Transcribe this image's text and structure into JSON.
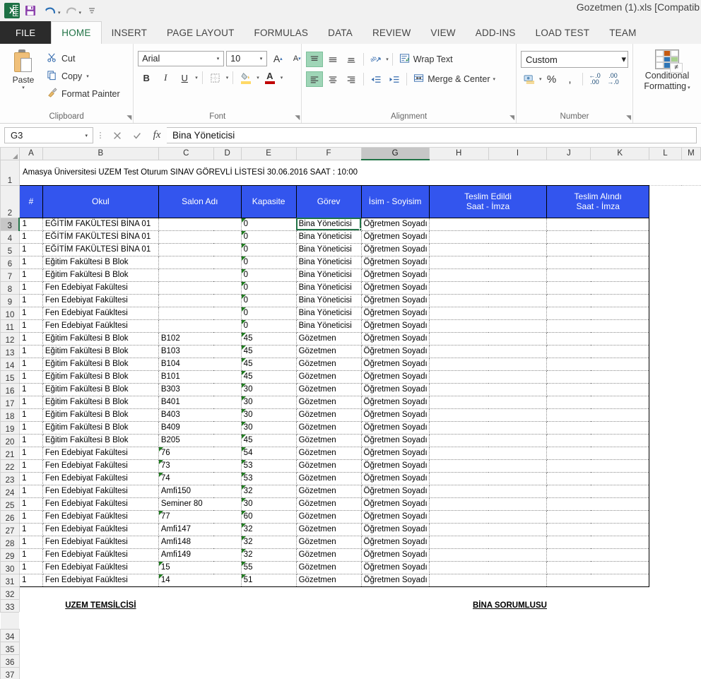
{
  "window": {
    "document_title": "Gozetmen (1).xls  [Compatib",
    "app_icon": "excel-logo-icon"
  },
  "quick_access": {
    "save": "save-icon",
    "undo": "undo-icon",
    "redo": "redo-icon",
    "customize": "customize-qat-icon"
  },
  "ribbon_tabs": [
    {
      "label": "FILE",
      "active": false
    },
    {
      "label": "HOME",
      "active": true
    },
    {
      "label": "INSERT",
      "active": false
    },
    {
      "label": "PAGE LAYOUT",
      "active": false
    },
    {
      "label": "FORMULAS",
      "active": false
    },
    {
      "label": "DATA",
      "active": false
    },
    {
      "label": "REVIEW",
      "active": false
    },
    {
      "label": "VIEW",
      "active": false
    },
    {
      "label": "ADD-INS",
      "active": false
    },
    {
      "label": "LOAD TEST",
      "active": false
    },
    {
      "label": "TEAM",
      "active": false
    }
  ],
  "ribbon": {
    "clipboard": {
      "group_label": "Clipboard",
      "paste_label": "Paste",
      "cut_label": "Cut",
      "copy_label": "Copy",
      "format_painter_label": "Format Painter"
    },
    "font": {
      "group_label": "Font",
      "font_name": "Arial",
      "font_size": "10",
      "bold_label": "B",
      "italic_label": "I",
      "underline_label": "U",
      "grow_font_label": "A",
      "shrink_font_label": "A",
      "fill_color": "#ffd966",
      "font_color": "#c00000"
    },
    "alignment": {
      "group_label": "Alignment",
      "wrap_text_label": "Wrap Text",
      "merge_center_label": "Merge & Center"
    },
    "number": {
      "group_label": "Number",
      "format_value": "Custom",
      "percent_label": "%",
      "comma_label": ",",
      "increase_decimal_label": ".00",
      "decrease_decimal_label": ".00"
    },
    "styles": {
      "conditional_formatting_line1": "Conditional",
      "conditional_formatting_line2": "Formatting"
    }
  },
  "formula_bar": {
    "name_box_value": "G3",
    "cancel_icon": "cancel-icon",
    "enter_icon": "confirm-icon",
    "fx_icon": "insert-function-icon",
    "content": "Bina Yöneticisi"
  },
  "sheet": {
    "columns": [
      "A",
      "B",
      "C",
      "D",
      "E",
      "F",
      "G",
      "H",
      "I",
      "J",
      "K",
      "L",
      "M"
    ],
    "selected_column": "G",
    "selected_row": 3,
    "selected_cell": "G3",
    "row_numbers": [
      1,
      2,
      3,
      4,
      5,
      6,
      7,
      8,
      9,
      10,
      11,
      12,
      13,
      14,
      15,
      16,
      17,
      18,
      19,
      20,
      21,
      22,
      23,
      24,
      25,
      26,
      27,
      28,
      29,
      30,
      31,
      32,
      33,
      34,
      35,
      36,
      37
    ],
    "title_row": "Amasya Üniversitesi UZEM Test Oturum  SINAV GÖREVLİ LİSTESİ 30.06.2016 SAAT : 10:00",
    "headers": [
      {
        "label": "#"
      },
      {
        "label": "Okul"
      },
      {
        "label": "Salon Adı"
      },
      {
        "label": "Kapasite"
      },
      {
        "label": "Görev"
      },
      {
        "label": "İsim - Soyisim"
      },
      {
        "line1": "Teslim Edildi",
        "line2": "Saat - İmza"
      },
      {
        "line1": "Teslim Alındı",
        "line2": "Saat - İmza"
      }
    ],
    "rows": [
      {
        "row": 3,
        "num": "1",
        "okul": "EĞİTİM FAKÜLTESİ BİNA 01",
        "salon": "",
        "kapasite": "0",
        "gorev": "Bina Yöneticisi",
        "isim": "Öğretmen Soyadı",
        "teslim_edildi": "",
        "teslim_alindi": "",
        "salon_err": false,
        "kapasite_err": true
      },
      {
        "row": 4,
        "num": "1",
        "okul": "EĞİTİM FAKÜLTESİ BİNA 01",
        "salon": "",
        "kapasite": "0",
        "gorev": "Bina Yöneticisi",
        "isim": "Öğretmen Soyadı",
        "teslim_edildi": "",
        "teslim_alindi": "",
        "salon_err": false,
        "kapasite_err": true
      },
      {
        "row": 5,
        "num": "1",
        "okul": "EĞİTİM FAKÜLTESİ BİNA 01",
        "salon": "",
        "kapasite": "0",
        "gorev": "Bina Yöneticisi",
        "isim": "Öğretmen Soyadı",
        "teslim_edildi": "",
        "teslim_alindi": "",
        "salon_err": false,
        "kapasite_err": true
      },
      {
        "row": 6,
        "num": "1",
        "okul": "Eğitim Fakültesi B Blok",
        "salon": "",
        "kapasite": "0",
        "gorev": "Bina Yöneticisi",
        "isim": "Öğretmen Soyadı",
        "teslim_edildi": "",
        "teslim_alindi": "",
        "salon_err": false,
        "kapasite_err": true
      },
      {
        "row": 7,
        "num": "1",
        "okul": "Eğitim Fakültesi B Blok",
        "salon": "",
        "kapasite": "0",
        "gorev": "Bina Yöneticisi",
        "isim": "Öğretmen Soyadı",
        "teslim_edildi": "",
        "teslim_alindi": "",
        "salon_err": false,
        "kapasite_err": true
      },
      {
        "row": 8,
        "num": "1",
        "okul": "Fen Edebiyat Fakültesi",
        "salon": "",
        "kapasite": "0",
        "gorev": "Bina Yöneticisi",
        "isim": "Öğretmen Soyadı",
        "teslim_edildi": "",
        "teslim_alindi": "",
        "salon_err": false,
        "kapasite_err": true
      },
      {
        "row": 9,
        "num": "1",
        "okul": "Fen Edebiyat Fakültesi",
        "salon": "",
        "kapasite": "0",
        "gorev": "Bina Yöneticisi",
        "isim": "Öğretmen Soyadı",
        "teslim_edildi": "",
        "teslim_alindi": "",
        "salon_err": false,
        "kapasite_err": true
      },
      {
        "row": 10,
        "num": "1",
        "okul": "Fen Edebiyat Faükltesi",
        "salon": "",
        "kapasite": "0",
        "gorev": "Bina Yöneticisi",
        "isim": "Öğretmen Soyadı",
        "teslim_edildi": "",
        "teslim_alindi": "",
        "salon_err": false,
        "kapasite_err": true
      },
      {
        "row": 11,
        "num": "1",
        "okul": "Fen Edebiyat Faükltesi",
        "salon": "",
        "kapasite": "0",
        "gorev": "Bina Yöneticisi",
        "isim": "Öğretmen Soyadı",
        "teslim_edildi": "",
        "teslim_alindi": "",
        "salon_err": false,
        "kapasite_err": true
      },
      {
        "row": 12,
        "num": "1",
        "okul": "Eğitim Fakültesi B Blok",
        "salon": "B102",
        "kapasite": "45",
        "gorev": "Gözetmen",
        "isim": "Öğretmen Soyadı",
        "teslim_edildi": "",
        "teslim_alindi": "",
        "salon_err": false,
        "kapasite_err": true
      },
      {
        "row": 13,
        "num": "1",
        "okul": "Eğitim Fakültesi B Blok",
        "salon": "B103",
        "kapasite": "45",
        "gorev": "Gözetmen",
        "isim": "Öğretmen Soyadı",
        "teslim_edildi": "",
        "teslim_alindi": "",
        "salon_err": false,
        "kapasite_err": true
      },
      {
        "row": 14,
        "num": "1",
        "okul": "Eğitim Fakültesi B Blok",
        "salon": "B104",
        "kapasite": "45",
        "gorev": "Gözetmen",
        "isim": "Öğretmen Soyadı",
        "teslim_edildi": "",
        "teslim_alindi": "",
        "salon_err": false,
        "kapasite_err": true
      },
      {
        "row": 15,
        "num": "1",
        "okul": "Eğitim Fakültesi B Blok",
        "salon": "B101",
        "kapasite": "45",
        "gorev": "Gözetmen",
        "isim": "Öğretmen Soyadı",
        "teslim_edildi": "",
        "teslim_alindi": "",
        "salon_err": false,
        "kapasite_err": true
      },
      {
        "row": 16,
        "num": "1",
        "okul": "Eğitim Fakültesi B Blok",
        "salon": "B303",
        "kapasite": "30",
        "gorev": "Gözetmen",
        "isim": "Öğretmen Soyadı",
        "teslim_edildi": "",
        "teslim_alindi": "",
        "salon_err": false,
        "kapasite_err": true
      },
      {
        "row": 17,
        "num": "1",
        "okul": "Eğitim Fakültesi B Blok",
        "salon": "B401",
        "kapasite": "30",
        "gorev": "Gözetmen",
        "isim": "Öğretmen Soyadı",
        "teslim_edildi": "",
        "teslim_alindi": "",
        "salon_err": false,
        "kapasite_err": true
      },
      {
        "row": 18,
        "num": "1",
        "okul": "Eğitim Fakültesi B Blok",
        "salon": "B403",
        "kapasite": "30",
        "gorev": "Gözetmen",
        "isim": "Öğretmen Soyadı",
        "teslim_edildi": "",
        "teslim_alindi": "",
        "salon_err": false,
        "kapasite_err": true
      },
      {
        "row": 19,
        "num": "1",
        "okul": "Eğitim Fakültesi B Blok",
        "salon": "B409",
        "kapasite": "30",
        "gorev": "Gözetmen",
        "isim": "Öğretmen Soyadı",
        "teslim_edildi": "",
        "teslim_alindi": "",
        "salon_err": false,
        "kapasite_err": true
      },
      {
        "row": 20,
        "num": "1",
        "okul": "Eğitim Fakültesi B Blok",
        "salon": "B205",
        "kapasite": "45",
        "gorev": "Gözetmen",
        "isim": "Öğretmen Soyadı",
        "teslim_edildi": "",
        "teslim_alindi": "",
        "salon_err": false,
        "kapasite_err": true
      },
      {
        "row": 21,
        "num": "1",
        "okul": "Fen Edebiyat Fakültesi",
        "salon": "76",
        "kapasite": "54",
        "gorev": "Gözetmen",
        "isim": "Öğretmen Soyadı",
        "teslim_edildi": "",
        "teslim_alindi": "",
        "salon_err": true,
        "kapasite_err": true
      },
      {
        "row": 22,
        "num": "1",
        "okul": "Fen Edebiyat Fakültesi",
        "salon": "73",
        "kapasite": "53",
        "gorev": "Gözetmen",
        "isim": "Öğretmen Soyadı",
        "teslim_edildi": "",
        "teslim_alindi": "",
        "salon_err": true,
        "kapasite_err": true
      },
      {
        "row": 23,
        "num": "1",
        "okul": "Fen Edebiyat Fakültesi",
        "salon": "74",
        "kapasite": "53",
        "gorev": "Gözetmen",
        "isim": "Öğretmen Soyadı",
        "teslim_edildi": "",
        "teslim_alindi": "",
        "salon_err": true,
        "kapasite_err": true
      },
      {
        "row": 24,
        "num": "1",
        "okul": "Fen Edebiyat Fakültesi",
        "salon": "Amfi150",
        "kapasite": "32",
        "gorev": "Gözetmen",
        "isim": "Öğretmen Soyadı",
        "teslim_edildi": "",
        "teslim_alindi": "",
        "salon_err": false,
        "kapasite_err": true
      },
      {
        "row": 25,
        "num": "1",
        "okul": "Fen Edebiyat Fakültesi",
        "salon": "Seminer 80",
        "kapasite": "30",
        "gorev": "Gözetmen",
        "isim": "Öğretmen Soyadı",
        "teslim_edildi": "",
        "teslim_alindi": "",
        "salon_err": false,
        "kapasite_err": true
      },
      {
        "row": 26,
        "num": "1",
        "okul": "Fen Edebiyat Faükltesi",
        "salon": "77",
        "kapasite": "60",
        "gorev": "Gözetmen",
        "isim": "Öğretmen Soyadı",
        "teslim_edildi": "",
        "teslim_alindi": "",
        "salon_err": true,
        "kapasite_err": true
      },
      {
        "row": 27,
        "num": "1",
        "okul": "Fen Edebiyat Faükltesi",
        "salon": "Amfi147",
        "kapasite": "32",
        "gorev": "Gözetmen",
        "isim": "Öğretmen Soyadı",
        "teslim_edildi": "",
        "teslim_alindi": "",
        "salon_err": false,
        "kapasite_err": true
      },
      {
        "row": 28,
        "num": "1",
        "okul": "Fen Edebiyat Faükltesi",
        "salon": "Amfi148",
        "kapasite": "32",
        "gorev": "Gözetmen",
        "isim": "Öğretmen Soyadı",
        "teslim_edildi": "",
        "teslim_alindi": "",
        "salon_err": false,
        "kapasite_err": true
      },
      {
        "row": 29,
        "num": "1",
        "okul": "Fen Edebiyat Faükltesi",
        "salon": "Amfi149",
        "kapasite": "32",
        "gorev": "Gözetmen",
        "isim": "Öğretmen Soyadı",
        "teslim_edildi": "",
        "teslim_alindi": "",
        "salon_err": false,
        "kapasite_err": true
      },
      {
        "row": 30,
        "num": "1",
        "okul": "Fen Edebiyat Faükltesi",
        "salon": "15",
        "kapasite": "55",
        "gorev": "Gözetmen",
        "isim": "Öğretmen Soyadı",
        "teslim_edildi": "",
        "teslim_alindi": "",
        "salon_err": true,
        "kapasite_err": true
      },
      {
        "row": 31,
        "num": "1",
        "okul": "Fen Edebiyat Faükltesi",
        "salon": "14",
        "kapasite": "51",
        "gorev": "Gözetmen",
        "isim": "Öğretmen Soyadı",
        "teslim_edildi": "",
        "teslim_alindi": "",
        "salon_err": true,
        "kapasite_err": true
      }
    ],
    "footer": {
      "left_label": "UZEM TEMSİLCİSİ",
      "right_label": "BİNA SORUMLUSU"
    }
  },
  "colors": {
    "header_blue": "#3355ee",
    "excel_green": "#217346",
    "error_flag_green": "#1e7a1e"
  }
}
